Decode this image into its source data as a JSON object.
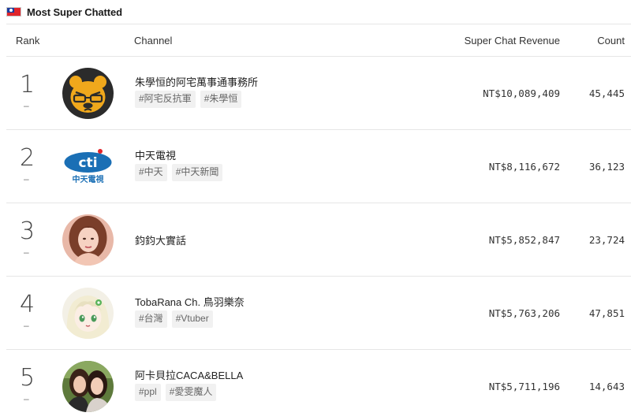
{
  "page": {
    "title": "Most Super Chatted",
    "flag_icon": "taiwan-flag-icon"
  },
  "table": {
    "columns": {
      "rank": "Rank",
      "channel": "Channel",
      "revenue": "Super Chat Revenue",
      "count": "Count"
    },
    "rows": [
      {
        "rank": "1",
        "rank_change": "–",
        "channel": "朱學恒的阿宅萬事通事務所",
        "tags": [
          "#阿宅反抗軍",
          "#朱學恒"
        ],
        "revenue": "NT$10,089,409",
        "count": "45,445",
        "avatar_icon": "cartoon-bear-avatar"
      },
      {
        "rank": "2",
        "rank_change": "–",
        "channel": "中天電視",
        "tags": [
          "#中天",
          "#中天新聞"
        ],
        "revenue": "NT$8,116,672",
        "count": "36,123",
        "avatar_icon": "cti-logo-avatar",
        "avatar_logo_text": "cti",
        "avatar_logo_subtext": "中天電視"
      },
      {
        "rank": "3",
        "rank_change": "–",
        "channel": "鈞鈞大實話",
        "tags": [],
        "revenue": "NT$5,852,847",
        "count": "23,724",
        "avatar_icon": "woman-portrait-avatar"
      },
      {
        "rank": "4",
        "rank_change": "–",
        "channel": "TobaRana Ch. 鳥羽樂奈",
        "tags": [
          "#台灣",
          "#Vtuber"
        ],
        "revenue": "NT$5,763,206",
        "count": "47,851",
        "avatar_icon": "anime-girl-avatar"
      },
      {
        "rank": "5",
        "rank_change": "–",
        "channel": "阿卡貝拉CACA&BELLA",
        "tags": [
          "#ppl",
          "#愛雯魔人"
        ],
        "revenue": "NT$5,711,196",
        "count": "14,643",
        "avatar_icon": "two-women-avatar"
      }
    ]
  },
  "colors": {
    "flag_red": "#e0242b",
    "flag_blue": "#1c3c9c",
    "tag_bg": "#f1f1f1",
    "divider": "#e6e6e6",
    "cti_blue": "#1a6fb5"
  }
}
